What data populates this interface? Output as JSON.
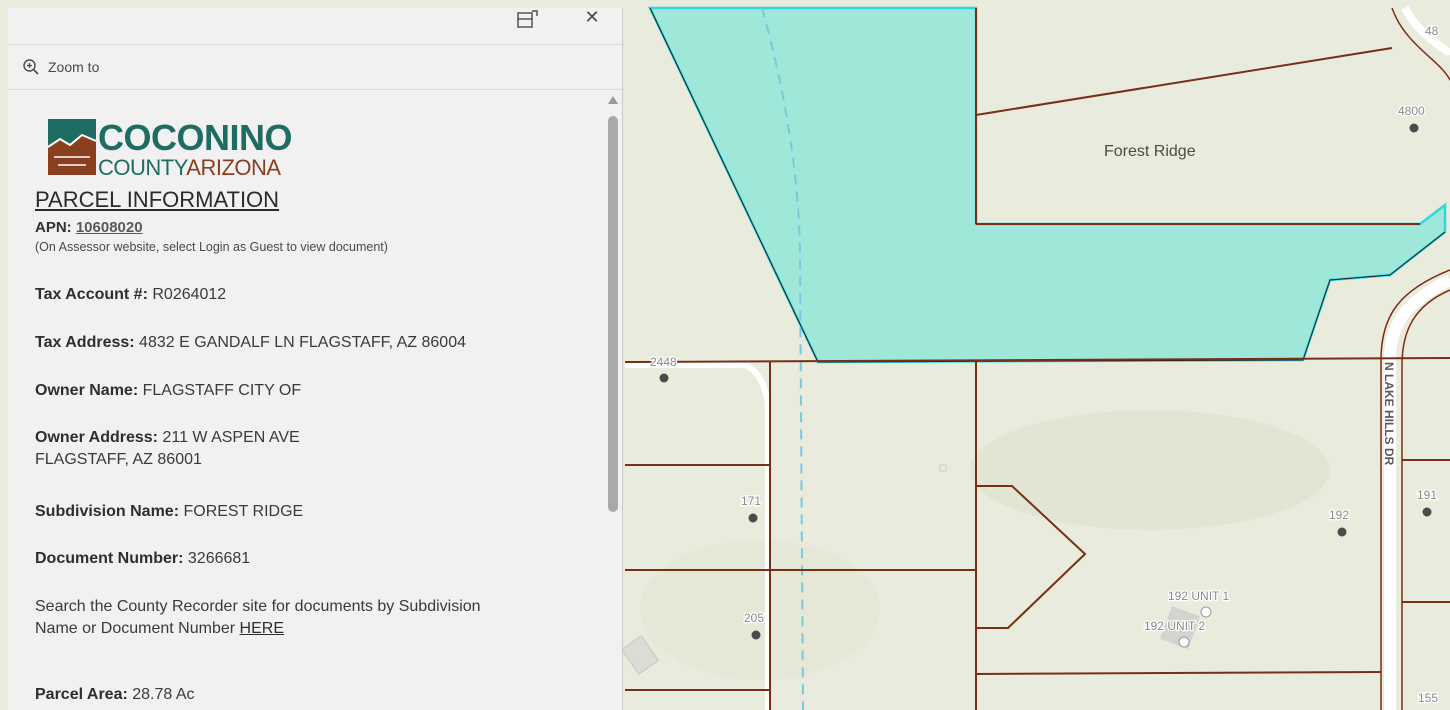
{
  "panel": {
    "zoom_label": "Zoom to",
    "logo_line1": "COCONINO",
    "logo_line2a": "COUNTY",
    "logo_line2b": "ARIZONA",
    "title": "PARCEL INFORMATION",
    "apn_label": "APN:",
    "apn_value": "10608020",
    "apn_note": "(On Assessor website, select Login as Guest to view document)",
    "fields": {
      "tax_account_label": "Tax Account #:",
      "tax_account_value": "R0264012",
      "tax_address_label": "Tax Address:",
      "tax_address_value": "4832 E GANDALF LN FLAGSTAFF, AZ 86004",
      "owner_name_label": "Owner Name:",
      "owner_name_value": "FLAGSTAFF CITY OF",
      "owner_address_label": "Owner Address:",
      "owner_address_value_1": "211 W ASPEN AVE",
      "owner_address_value_2": "FLAGSTAFF, AZ 86001",
      "subdivision_label": "Subdivision Name:",
      "subdivision_value": "FOREST RIDGE",
      "document_label": "Document Number:",
      "document_value": "3266681",
      "search_text_1": "Search the County Recorder site for documents by Subdivision",
      "search_text_2": "Name or Document Number",
      "search_link": "HERE",
      "parcel_area_label": "Parcel Area:",
      "parcel_area_value": "28.78 Ac"
    }
  },
  "map": {
    "area_label": "Forest Ridge",
    "street_label": "N LAKE HILLS DR",
    "address_labels": {
      "a2448": "2448",
      "a171": "171",
      "a205": "205",
      "a192": "192",
      "a191": "191",
      "a4800": "4800",
      "a48": "48",
      "a155": "155",
      "unit1": "192 UNIT 1",
      "unit2": "192 UNIT 2"
    },
    "colors": {
      "background": "#e9ebdd",
      "selected_fill": "#9fe8d9",
      "selected_outline": "#2fd6e0",
      "parcel_line": "#7a2e15"
    }
  }
}
